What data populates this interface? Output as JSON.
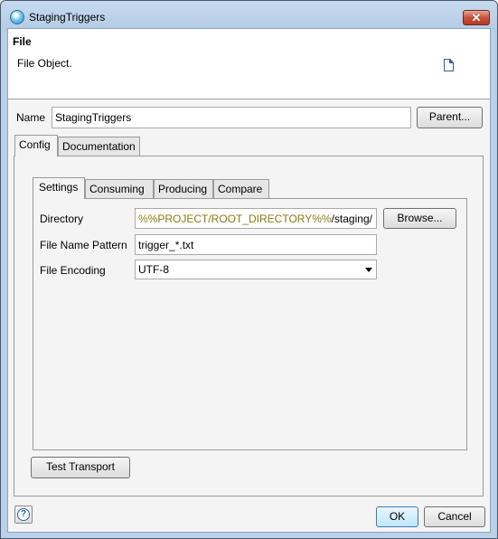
{
  "window": {
    "title": "StagingTriggers",
    "app_icon": "globe-icon",
    "close_label": "✕"
  },
  "header": {
    "title": "File",
    "description": "File Object.",
    "icon": "document-icon"
  },
  "name_row": {
    "label": "Name",
    "value": "StagingTriggers",
    "parent_button": "Parent..."
  },
  "outer_tabs": [
    {
      "label": "Config",
      "active": true
    },
    {
      "label": "Documentation",
      "active": false
    }
  ],
  "inner_tabs": [
    {
      "label": "Settings",
      "active": true
    },
    {
      "label": "Consuming",
      "active": false
    },
    {
      "label": "Producing",
      "active": false
    },
    {
      "label": "Compare",
      "active": false
    }
  ],
  "settings": {
    "directory": {
      "label": "Directory",
      "value_variable": "%%PROJECT/ROOT_DIRECTORY%%",
      "value_suffix": "/staging/",
      "browse_button": "Browse...",
      "variable_color": "#8a7a10"
    },
    "file_name_pattern": {
      "label": "File Name Pattern",
      "value": "trigger_*.txt"
    },
    "file_encoding": {
      "label": "File Encoding",
      "value": "UTF-8"
    }
  },
  "buttons": {
    "test_transport": "Test Transport",
    "help": "?",
    "ok": "OK",
    "cancel": "Cancel"
  }
}
